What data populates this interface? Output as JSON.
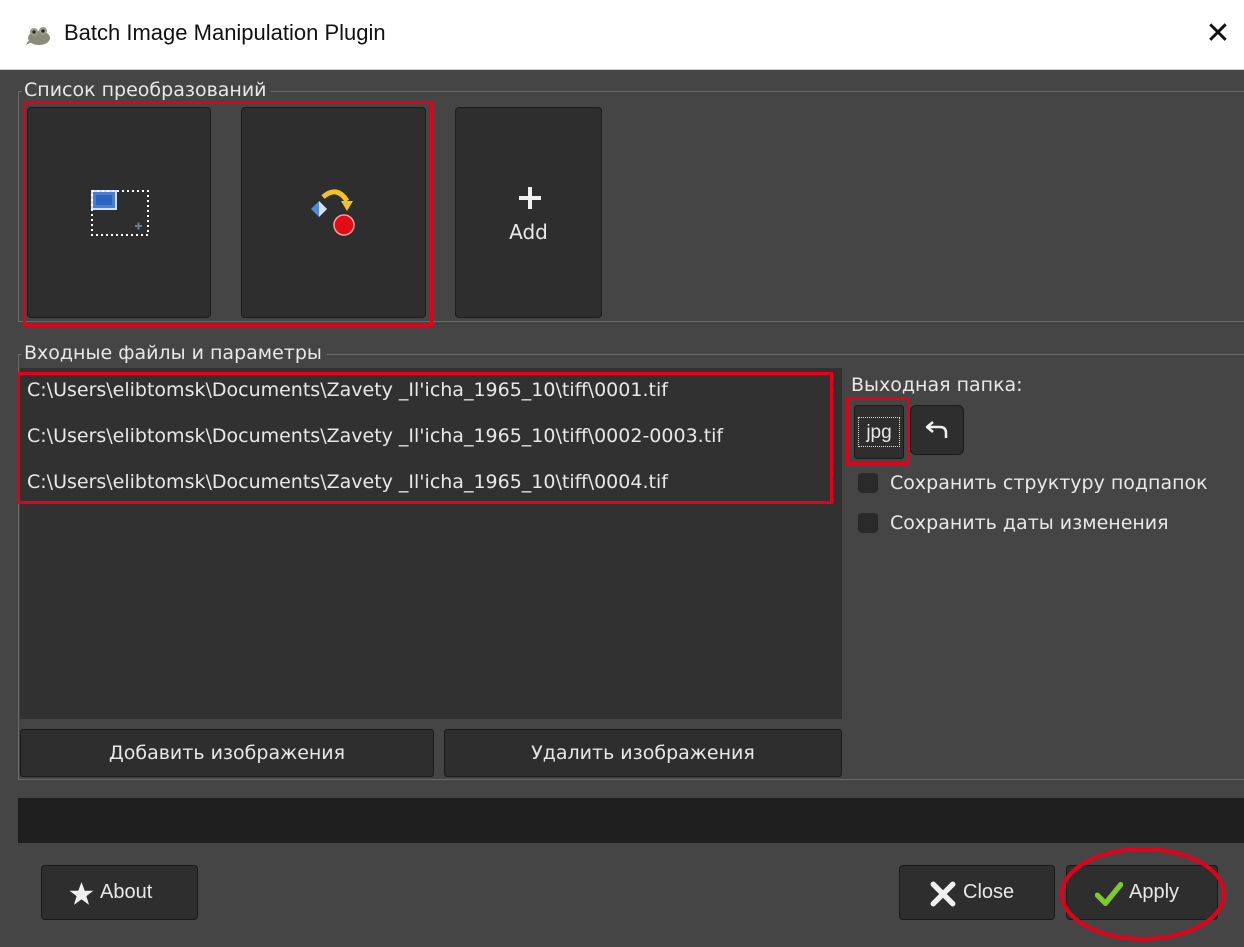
{
  "window": {
    "title": "Batch Image Manipulation Plugin",
    "close_glyph": "✕"
  },
  "transforms": {
    "group_label": "Список преобразований",
    "items": [
      {
        "icon": "crop-resize-icon"
      },
      {
        "icon": "rotate-icon"
      }
    ],
    "add_label": "Add"
  },
  "inputs": {
    "group_label": "Входные файлы и параметры",
    "files": [
      "C:\\Users\\elibtomsk\\Documents\\Zavety _Il'icha_1965_10\\tiff\\0001.tif",
      "C:\\Users\\elibtomsk\\Documents\\Zavety _Il'icha_1965_10\\tiff\\0002-0003.tif",
      "C:\\Users\\elibtomsk\\Documents\\Zavety _Il'icha_1965_10\\tiff\\0004.tif"
    ],
    "add_images_label": "Добавить изображения",
    "remove_images_label": "Удалить изображения"
  },
  "output": {
    "label": "Выходная папка:",
    "folder_value": "jpg",
    "keep_structure_label": "Сохранить структуру подпапок",
    "keep_dates_label": "Сохранить даты изменения",
    "keep_structure_checked": false,
    "keep_dates_checked": false
  },
  "footer": {
    "about_label": "About",
    "close_label": "Close",
    "apply_label": "Apply"
  },
  "colors": {
    "background": "#454545",
    "highlight": "#e3001b",
    "apply_check": "#7ec92b"
  }
}
